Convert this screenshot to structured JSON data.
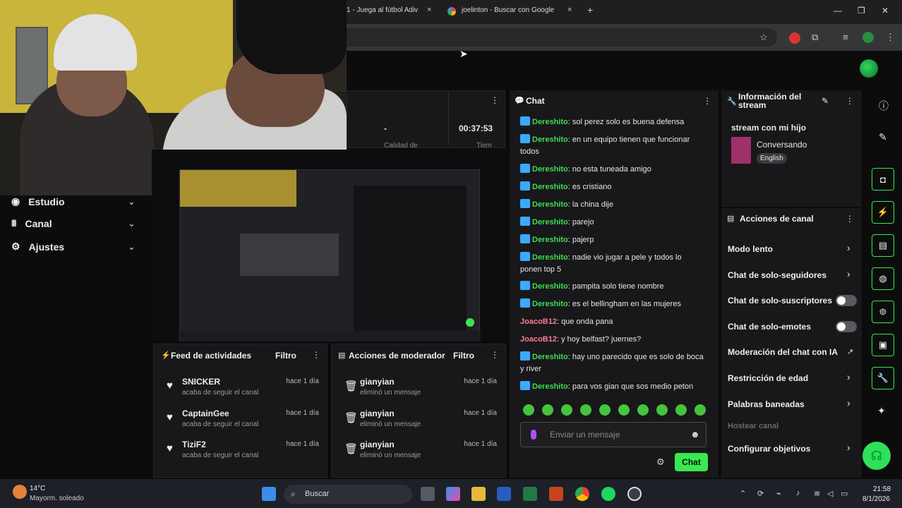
{
  "browser": {
    "tabs": [
      {
        "label": "1 - Juega al fútbol Adiv"
      },
      {
        "label": "joelinton - Buscar con Google"
      }
    ],
    "new_tab": "+",
    "tab_close": "×",
    "window_min": "—",
    "window_max": "❐",
    "window_close": "✕"
  },
  "sidebar": {
    "items": [
      {
        "label": "Estudio",
        "icon": "studio-icon"
      },
      {
        "label": "Canal",
        "icon": "channel-icon"
      },
      {
        "label": "Ajustes",
        "icon": "gear-icon"
      }
    ]
  },
  "stats": {
    "dash": "-",
    "time": "00:37:53",
    "partial_left": "Calidad de",
    "partial_right": "Tiem"
  },
  "feed": {
    "title": "Feed de actividades",
    "filter": "Filtro",
    "items": [
      {
        "name": "SNICKER",
        "sub": "acaba de seguir el canal",
        "time": "hace 1 día"
      },
      {
        "name": "CaptainGee",
        "sub": "acaba de seguir el canal",
        "time": "hace 1 día"
      },
      {
        "name": "TiziF2",
        "sub": "acaba de seguir el canal",
        "time": "hace 1 día"
      }
    ]
  },
  "mod_actions": {
    "title": "Acciones de moderador",
    "filter": "Filtro",
    "items": [
      {
        "name": "gianyian",
        "sub": "eliminó un mensaje",
        "time": "hace 1 día"
      },
      {
        "name": "gianyian",
        "sub": "eliminó un mensaje",
        "time": "hace 1 día"
      },
      {
        "name": "gianyian",
        "sub": "eliminó un mensaje",
        "time": "hace 1 día"
      }
    ]
  },
  "chat": {
    "title": "Chat",
    "messages": [
      {
        "user": "Dereshito",
        "text": "sol perez solo es buena defensa"
      },
      {
        "user": "Dereshito",
        "text": "en un equipo tienen que funcionar todos"
      },
      {
        "user": "Dereshito",
        "text": "no esta tuneada amigo"
      },
      {
        "user": "Dereshito",
        "text": "es cristiano"
      },
      {
        "user": "Dereshito",
        "text": "la china dije"
      },
      {
        "user": "Dereshito",
        "text": "parejo"
      },
      {
        "user": "Dereshito",
        "text": "pajerp"
      },
      {
        "user": "Dereshito",
        "text": "nadie vio jugar a pele y todos lo ponen top 5"
      },
      {
        "user": "Dereshito",
        "text": "pampita solo tiene nombre"
      },
      {
        "user": "Dereshito",
        "text": "es el bellingham en las mujeres"
      },
      {
        "user": "JoacoB12",
        "text": "que onda pana"
      },
      {
        "user": "JoacoB12",
        "text": "y hoy belfast? juernes?"
      },
      {
        "user": "Dereshito",
        "text": "hay uno parecido que es solo de boca y river"
      },
      {
        "user": "Dereshito",
        "text": "para vos gian que sos medio peton"
      }
    ],
    "placeholder": "Enviar un mensaje",
    "send_label": "Chat"
  },
  "stream_info": {
    "title": "Información del stream",
    "stream_title": "stream con mi hijo",
    "category": "Conversando",
    "language": "English"
  },
  "channel_actions": {
    "title": "Acciones de canal",
    "items": [
      {
        "label": "Modo lento"
      },
      {
        "label": "Chat de solo-seguidores"
      },
      {
        "label": "Chat de solo-suscriptores"
      },
      {
        "label": "Chat de solo-emotes"
      },
      {
        "label": "Moderación del chat con IA"
      },
      {
        "label": "Restricción de edad"
      },
      {
        "label": "Palabras baneadas"
      },
      {
        "label": "Hostear canal"
      },
      {
        "label": "Configurar objetivos"
      }
    ],
    "toggles": {
      "subscribers_only": false,
      "emotes_only": false
    }
  },
  "taskbar": {
    "weather_temp": "14°C",
    "weather_desc": "Mayorm. soleado",
    "search": "Buscar",
    "time": "21:58",
    "date": "8/1/2026"
  },
  "colors": {
    "accent": "#39e84e",
    "username": "#3ddc53",
    "panel": "#18181a"
  }
}
